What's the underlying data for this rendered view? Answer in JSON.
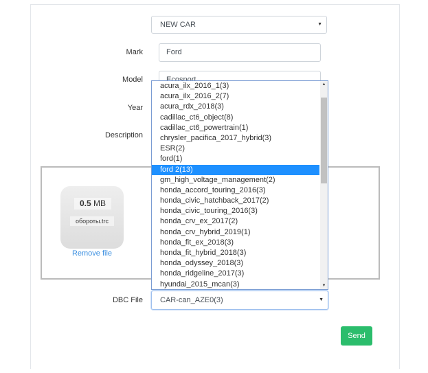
{
  "car_select": {
    "value": "NEW CAR"
  },
  "form": {
    "mark_label": "Mark",
    "mark_value": "Ford",
    "model_label": "Model",
    "model_value": "Ecosport",
    "year_label": "Year",
    "description_label": "Description",
    "dbc_label": "DBC File",
    "dbc_value": "CAR-can_AZE0(3)"
  },
  "file": {
    "size_num": "0.5",
    "size_unit": "MB",
    "name": "обороты.trc",
    "remove_label": "Remove file"
  },
  "dbc_options": [
    "acura_ilx_2016_1(3)",
    "acura_ilx_2016_2(7)",
    "acura_rdx_2018(3)",
    "cadillac_ct6_object(8)",
    "cadillac_ct6_powertrain(1)",
    "chrysler_pacifica_2017_hybrid(3)",
    "ESR(2)",
    "ford(1)",
    "ford 2(13)",
    "gm_high_voltage_management(2)",
    "honda_accord_touring_2016(3)",
    "honda_civic_hatchback_2017(2)",
    "honda_civic_touring_2016(3)",
    "honda_crv_ex_2017(2)",
    "honda_crv_hybrid_2019(1)",
    "honda_fit_ex_2018(3)",
    "honda_fit_hybrid_2018(3)",
    "honda_odyssey_2018(3)",
    "honda_ridgeline_2017(3)",
    "hyundai_2015_mcan(3)"
  ],
  "dbc_highlighted": "ford 2(13)",
  "send_label": "Send",
  "colors": {
    "highlight": "#1e90ff",
    "send": "#2bbd6c",
    "link": "#3b8fe0"
  }
}
